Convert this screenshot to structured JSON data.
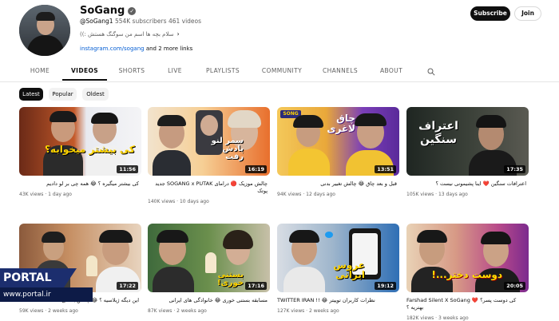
{
  "channel": {
    "name": "SoGang",
    "handle": "@SoGang1",
    "subscribers": "554K subscribers",
    "videos_count": "461 videos",
    "description": "سلام بچه ها اسم من سوگنگ هستش :))",
    "link": "instagram.com/sogang",
    "more_links": "and 2 more links",
    "subscribe_label": "Subscribe",
    "join_label": "Join"
  },
  "tabs": [
    {
      "label": "HOME"
    },
    {
      "label": "VIDEOS"
    },
    {
      "label": "SHORTS"
    },
    {
      "label": "LIVE"
    },
    {
      "label": "PLAYLISTS"
    },
    {
      "label": "COMMUNITY"
    },
    {
      "label": "CHANNELS"
    },
    {
      "label": "ABOUT"
    }
  ],
  "active_tab": "VIDEOS",
  "chips": [
    {
      "label": "Latest"
    },
    {
      "label": "Popular"
    },
    {
      "label": "Oldest"
    }
  ],
  "videos": [
    {
      "title": "کی بیشتر میگیره ؟ 😂 همه چی بر لو دادیم",
      "views": "43K views",
      "age": "1 day ago",
      "duration": "11:56",
      "thumb_text": "کی بیشتر میخوابه؟"
    },
    {
      "title": "چالش موزیک 🔴 درامای SOGANG x PUTAK جدید پوتک",
      "views": "140K views",
      "age": "10 days ago",
      "duration": "16:19",
      "thumb_text": "سمر لنو پادش رفت"
    },
    {
      "title": "قبل و بعد چاق 😂 چالش تغییر بدنی",
      "views": "94K views",
      "age": "12 days ago",
      "duration": "13:51",
      "thumb_text": "چاق لاغری",
      "thumb_badge": "SONG"
    },
    {
      "title": "اعترافات سنگین ❤️ اینا پشیمونی نیست ؟",
      "views": "105K views",
      "age": "13 days ago",
      "duration": "17:35",
      "thumb_text": "اعتراف سنگین"
    },
    {
      "title": "این دیگه ژیلاسیه ؟ 😂 چالش بستنی",
      "views": "59K views",
      "age": "2 weeks ago",
      "duration": "17:22",
      "thumb_text": ""
    },
    {
      "title": "مسابقه بستنی خوری 😂 خانوادگی های ایرانی",
      "views": "87K views",
      "age": "2 weeks ago",
      "duration": "17:16",
      "thumb_text": "بستنی خوری!"
    },
    {
      "title": "TWITTER IRAN !! 😂 نظرات کاربران توییتر",
      "views": "127K views",
      "age": "2 weeks ago",
      "duration": "19:12",
      "thumb_text": "عروس ایرانی"
    },
    {
      "title": "Farshad Silent X SoGang ❤️ کی دوست پسر؟ بهتریه ؟",
      "views": "182K views",
      "age": "3 weeks ago",
      "duration": "20:05",
      "thumb_text": "دوست دختر...!"
    }
  ],
  "watermark": {
    "brand": "PORTAL",
    "url": "www.portal.ir"
  },
  "colors": {
    "accent": "#0f0f0f",
    "link": "#065fd4",
    "meta": "#606060"
  }
}
